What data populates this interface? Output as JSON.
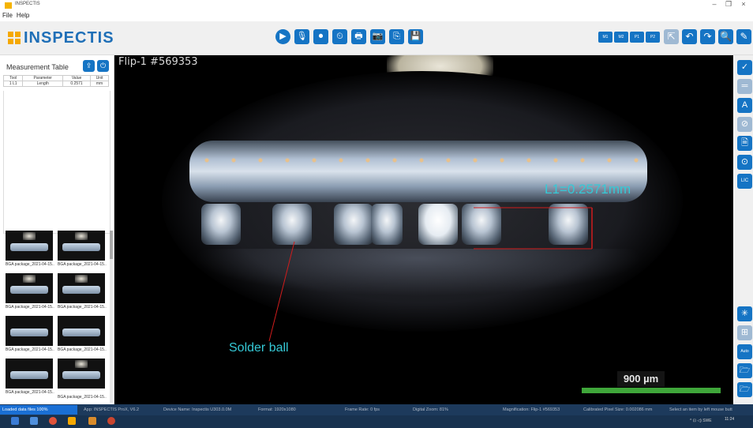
{
  "window": {
    "title": "INSPECTIS",
    "controls": [
      "–",
      "❐",
      "×"
    ]
  },
  "menu": [
    "File",
    "Help"
  ],
  "logo": {
    "text": "INSPECTIS",
    "accent": "#f5a800",
    "brand": "#1f6fb7"
  },
  "toolbar": {
    "center_icons": [
      "play-icon",
      "microphone-icon",
      "record-video-icon",
      "timelapse-icon",
      "print-icon",
      "camera-icon",
      "copy-icon",
      "save-icon"
    ],
    "center_glyphs": [
      "▶",
      "🎙",
      "⏺",
      "⏲",
      "🖶",
      "📷",
      "⎘",
      "💾"
    ],
    "small_buttons": [
      "M1",
      "M2",
      "P1",
      "P2"
    ],
    "right_glyphs": [
      "⇱",
      "↶",
      "↷",
      "🔍",
      "✎"
    ]
  },
  "measurement_table": {
    "title": "Measurement Table",
    "headers": [
      "Tool",
      "Parameter",
      "Value",
      "Unit"
    ],
    "rows": [
      [
        "1 L1",
        "Length",
        "0.2571",
        "mm"
      ]
    ]
  },
  "thumbnails": [
    "BGA package_2021-04-15...",
    "BGA package_2021-04-15...",
    "BGA package_2021-04-15...",
    "BGA package_2021-04-15...",
    "BGA package_2021-04-15...",
    "BGA package_2021-04-15...",
    "BGA package_2021-04-15...",
    "BGA package_2021-04-15..."
  ],
  "viewer": {
    "image_label": "Flip-1  #569353",
    "measurement_label": "L1=0.2571mm",
    "annotation_label": "Solder ball",
    "scale_label": "900 µm",
    "colors": {
      "annotation": "#35c9d6",
      "measure_line": "#d01c1c",
      "scale_bar": "#3fa63a"
    }
  },
  "right_tools": [
    "✓",
    "═",
    "A",
    "⊘",
    "🗎",
    "⊙",
    "LIC",
    "✳",
    "⊞",
    "Auto",
    "🗁",
    "🗁"
  ],
  "status": {
    "progress_text": "Loaded data files 100%",
    "app": "App: INSPECTIS ProX, V6.2",
    "device": "Device Name: Inspectis U303.0.0M",
    "format": "Format: 1920x1080",
    "frame_rate": "Frame Rate: 0 fps",
    "digital_zoom": "Digital Zoom: 81%",
    "magnification": "Magnification: Flip-1 #569353",
    "pixel_size": "Calibrated Pixel Size: 0.002086 mm",
    "hint": "Select an item by left mouse butt"
  },
  "taskbar": {
    "clock": "11:24",
    "tray": "^ ⊡ ◁) SWE"
  }
}
